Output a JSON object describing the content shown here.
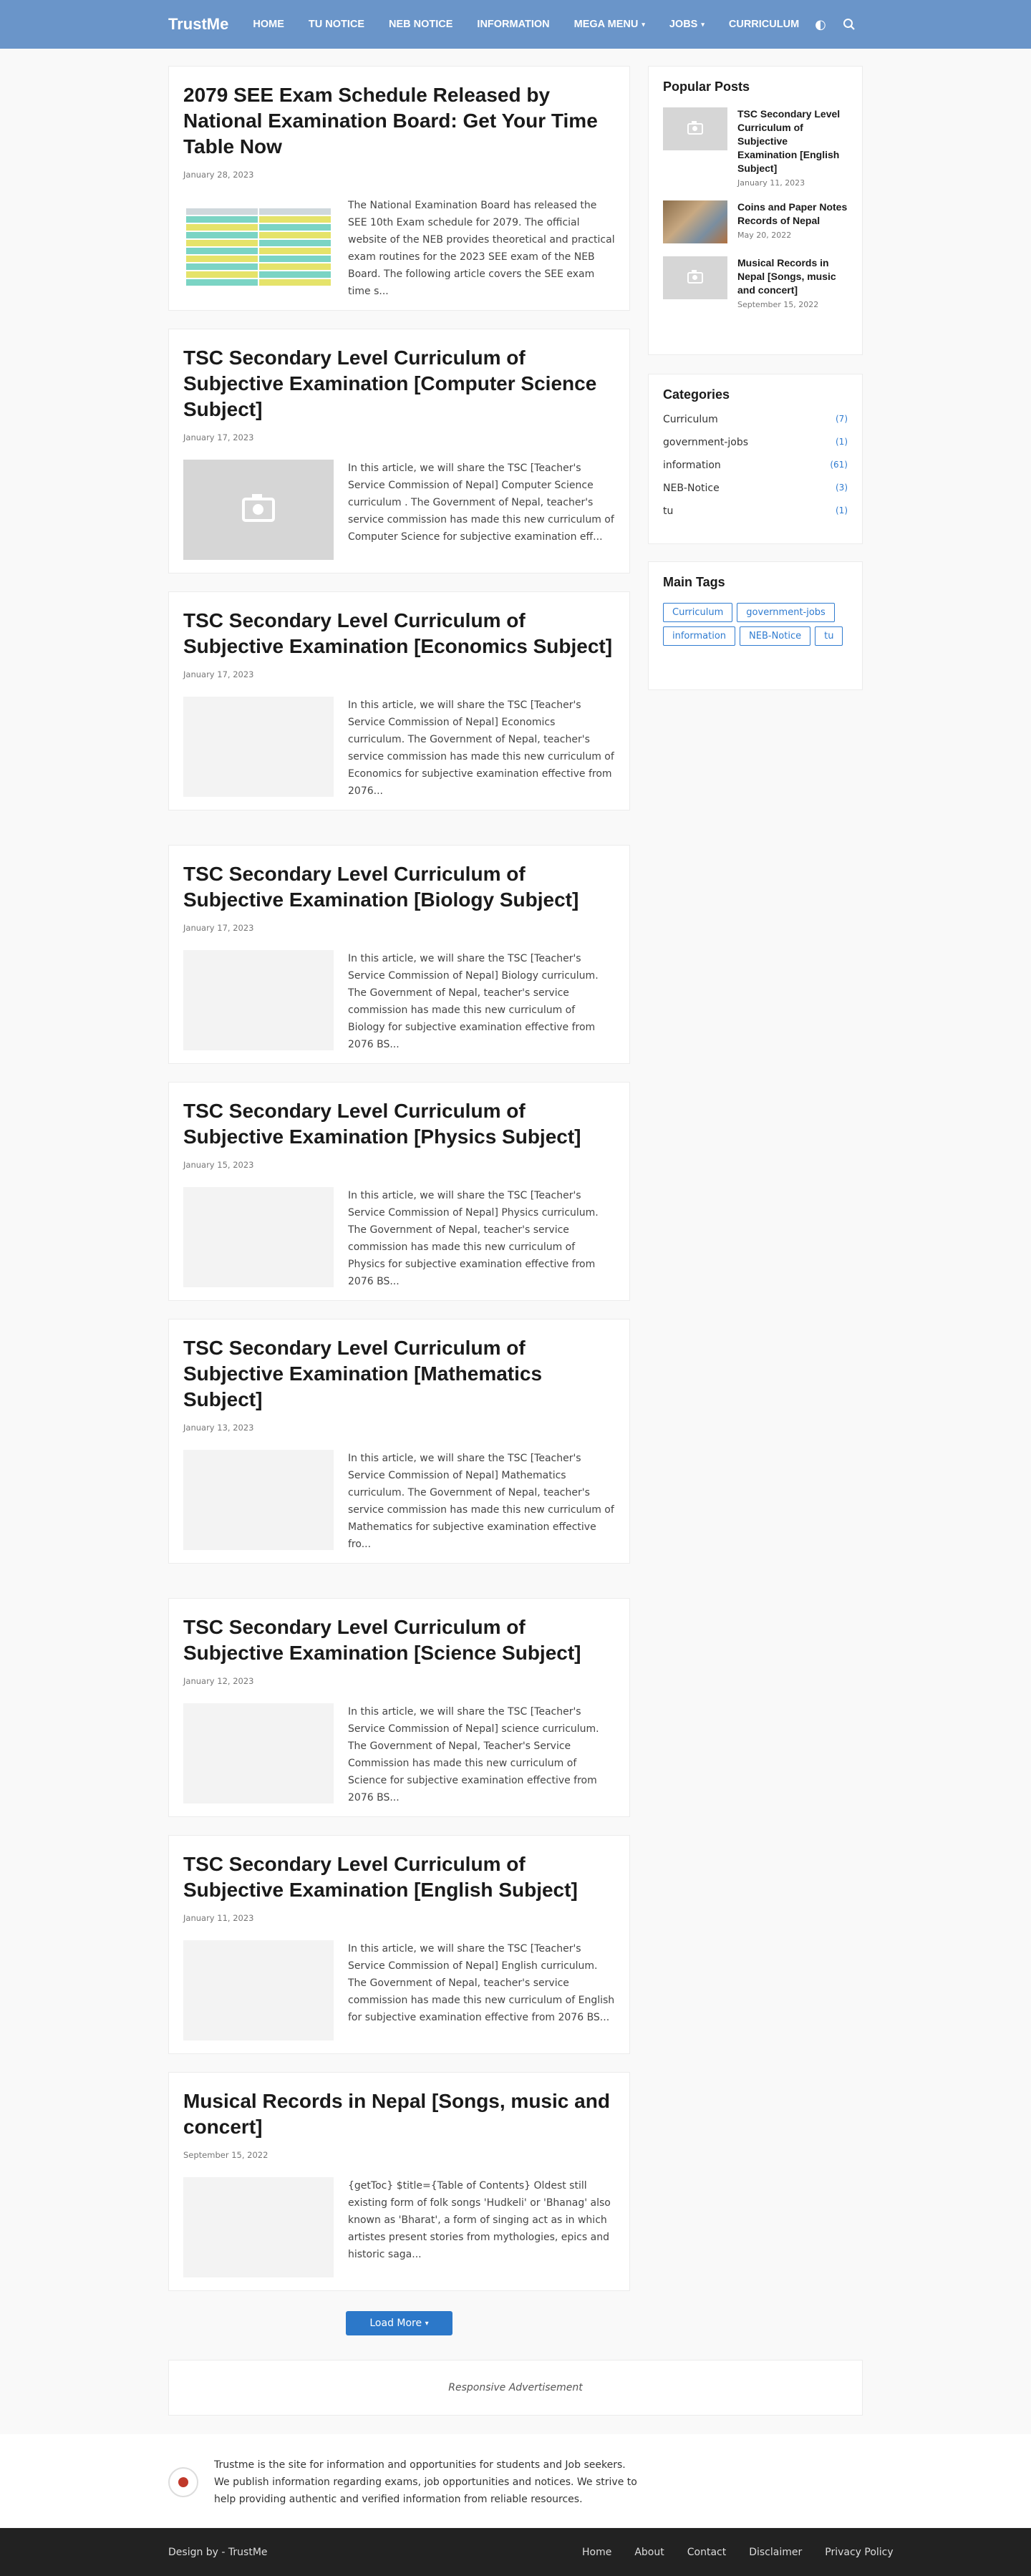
{
  "header": {
    "logo": "TrustMe",
    "nav": [
      "HOME",
      "TU NOTICE",
      "NEB NOTICE",
      "INFORMATION",
      "MEGA MENU",
      "JOBS",
      "CURRICULUM"
    ],
    "caret": "▾",
    "icons": [
      "theme-toggle-icon",
      "search-icon"
    ]
  },
  "posts": [
    {
      "title": "2079 SEE Exam Schedule Released by National Examination Board: Get Your Time Table Now",
      "date": "January 28, 2023",
      "snippet": "The National Examination Board has released the SEE 10th Exam schedule for 2079. The official website of the NEB provides theoretical and practical exam routines for the 2023 SEE exam of the NEB Board. The following article covers the SEE exam time s..."
    },
    {
      "title": "TSC Secondary Level Curriculum of Subjective Examination [Computer Science Subject]",
      "date": "January 17, 2023",
      "snippet": "In this article, we will share the TSC [Teacher's Service Commission of Nepal] Computer Science curriculum . The Government of Nepal, teacher's service commission has made this new curriculum of Computer Science for subjective examination eff..."
    },
    {
      "title": "TSC Secondary Level Curriculum of Subjective Examination [Economics Subject]",
      "date": "January 17, 2023",
      "snippet": "In this article, we will share the TSC [Teacher's Service Commission of Nepal] Economics curriculum. The Government of Nepal, teacher's service commission has made this new curriculum of Economics for subjective examination effective from 2076..."
    },
    {
      "title": "TSC Secondary Level Curriculum of Subjective Examination [Biology Subject]",
      "date": "January 17, 2023",
      "snippet": "In this article, we will share the TSC [Teacher's Service Commission of Nepal] Biology curriculum. The Government of Nepal, teacher's service commission has made this new curriculum of Biology  for subjective examination effective from 2076 BS..."
    },
    {
      "title": "TSC Secondary Level Curriculum of Subjective Examination [Physics Subject]",
      "date": "January 15, 2023",
      "snippet": "In this article, we will share the TSC [Teacher's Service Commission of Nepal] Physics curriculum. The Government of Nepal, teacher's service commission has made this new curriculum of Physics  for subjective examination effective from 2076 BS..."
    },
    {
      "title": "TSC Secondary Level Curriculum of Subjective Examination [Mathematics Subject]",
      "date": "January 13, 2023",
      "snippet": "In this article, we will share the TSC [Teacher's Service Commission of Nepal] Mathematics curriculum. The Government of Nepal, teacher's service commission has made this new curriculum of Mathematics for subjective examination effective fro..."
    },
    {
      "title": "TSC Secondary Level Curriculum of Subjective Examination [Science Subject]",
      "date": "January 12, 2023",
      "snippet": "In this article, we will share the TSC [Teacher's Service Commission of Nepal] science curriculum. The Government of Nepal, Teacher's Service Commission has made this new curriculum of Science for subjective examination effective from 2076 BS..."
    },
    {
      "title": "TSC Secondary Level Curriculum of Subjective Examination [English Subject]",
      "date": "January 11, 2023",
      "snippet": "In this article, we will share the TSC [Teacher's Service Commission of Nepal] English curriculum. The Government of Nepal, teacher's service commission has made this new curriculum of English for subjective examination effective from 2076 BS..."
    },
    {
      "title": "Musical Records in Nepal [Songs, music and concert]",
      "date": "September 15, 2022",
      "snippet": "{getToc} $title={Table of Contents} Oldest still existing form of folk songs 'Hudkeli' or 'Bhanag' also known as 'Bharat', a form of singing act as in which artistes present stories from mythologies, epics and historic saga..."
    }
  ],
  "sidebar": {
    "popular_title": "Popular Posts",
    "popular": [
      {
        "title": "TSC Secondary Level Curriculum of Subjective Examination [English Subject]",
        "date": "January 11, 2023"
      },
      {
        "title": "Coins and Paper Notes Records of Nepal",
        "date": "May 20, 2022"
      },
      {
        "title": "Musical Records in Nepal [Songs, music and concert]",
        "date": "September 15, 2022"
      }
    ],
    "categories_title": "Categories",
    "categories": [
      {
        "name": "Curriculum",
        "count": "(7)"
      },
      {
        "name": "government-jobs",
        "count": "(1)"
      },
      {
        "name": "information",
        "count": "(61)"
      },
      {
        "name": "NEB-Notice",
        "count": "(3)"
      },
      {
        "name": "tu",
        "count": "(1)"
      }
    ],
    "tags_title": "Main Tags",
    "tags": [
      "Curriculum",
      "government-jobs",
      "information",
      "NEB-Notice",
      "tu"
    ]
  },
  "load_more": "Load More",
  "ad_text": "Responsive Advertisement",
  "footer": {
    "about": "Trustme is the site for information and opportunities for students and Job seekers. We publish information regarding exams, job opportunities and notices. We strive to help providing authentic and verified information from reliable resources.",
    "design": "Design by - TrustMe",
    "links": [
      "Home",
      "About",
      "Contact",
      "Disclaimer",
      "Privacy Policy"
    ]
  },
  "colors": {
    "header": "#6a95c9",
    "accent": "#2c78c9"
  }
}
